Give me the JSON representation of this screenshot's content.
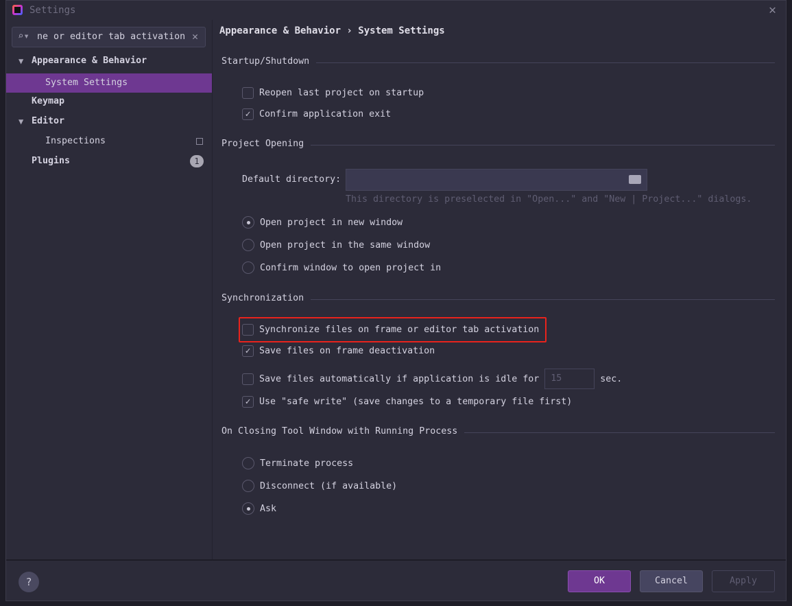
{
  "window": {
    "title": "Settings",
    "close_icon": "close-icon"
  },
  "sidebar": {
    "search": {
      "value": "ne or editor tab activation"
    },
    "items": [
      {
        "label": "Appearance & Behavior",
        "expanded": true
      },
      {
        "label": "System Settings",
        "selected": true
      },
      {
        "label": "Keymap"
      },
      {
        "label": "Editor",
        "expanded": true
      },
      {
        "label": "Inspections"
      },
      {
        "label": "Plugins",
        "badge": "1"
      }
    ]
  },
  "main": {
    "breadcrumb": "Appearance & Behavior  ›  System Settings",
    "startup": {
      "title": "Startup/Shutdown",
      "reopen": "Reopen last project on startup",
      "reopen_checked": false,
      "confirm_exit": "Confirm application exit",
      "confirm_exit_checked": true
    },
    "project_opening": {
      "title": "Project Opening",
      "default_dir_label": "Default directory:",
      "default_dir_value": "",
      "hint": "This directory is preselected in \"Open...\" and \"New | Project...\" dialogs.",
      "options": [
        "Open project in new window",
        "Open project in the same window",
        "Confirm window to open project in"
      ],
      "selected": "Open project in new window"
    },
    "sync": {
      "title": "Synchronization",
      "sync_files": "Synchronize files on frame or editor tab activation",
      "sync_checked": false,
      "save_deactivation": "Save files on frame deactivation",
      "save_deactivation_checked": true,
      "save_idle": "Save files automatically if application is idle for",
      "save_idle_checked": false,
      "idle_value": "15",
      "idle_unit": "sec.",
      "safe_write": "Use \"safe write\" (save changes to a temporary file first)",
      "safe_write_checked": true
    },
    "closing": {
      "title": "On Closing Tool Window with Running Process",
      "options": [
        "Terminate process",
        "Disconnect (if available)",
        "Ask"
      ],
      "selected": "Ask"
    }
  },
  "footer": {
    "help": "?",
    "ok": "OK",
    "cancel": "Cancel",
    "apply": "Apply"
  },
  "colors": {
    "accent": "#6e3891",
    "highlight_box": "#e8231c",
    "background": "#2c2b39"
  }
}
